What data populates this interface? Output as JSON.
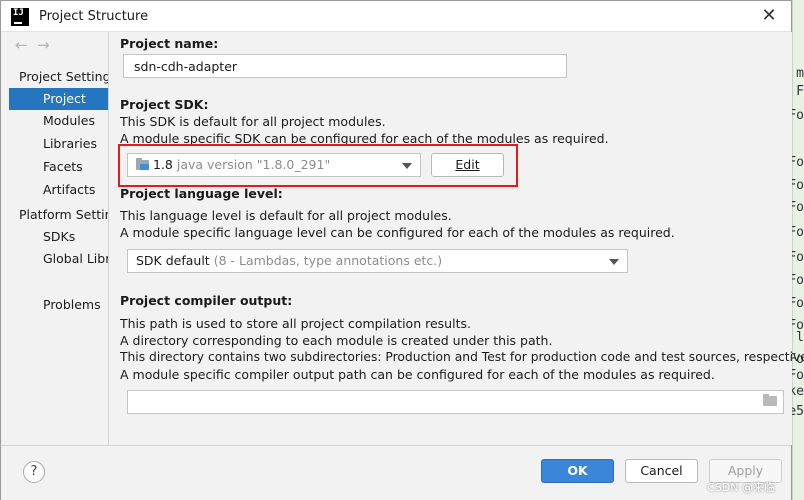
{
  "window": {
    "title": "Project Structure",
    "close_glyph": "✕",
    "app_icon_text": "IJ"
  },
  "sidebar": {
    "back_arrow": "←",
    "forward_arrow": "→",
    "project_settings_header": "Project Settings",
    "project_settings_items": [
      {
        "label": "Project",
        "selected": true
      },
      {
        "label": "Modules"
      },
      {
        "label": "Libraries"
      },
      {
        "label": "Facets"
      },
      {
        "label": "Artifacts"
      }
    ],
    "platform_settings_header": "Platform Settings",
    "platform_settings_items": [
      {
        "label": "SDKs"
      },
      {
        "label": "Global Libraries"
      }
    ],
    "problems_label": "Problems"
  },
  "project_name": {
    "label": "Project name:",
    "value": "sdn-cdh-adapter"
  },
  "project_sdk": {
    "label": "Project SDK:",
    "desc_line1": "This SDK is default for all project modules.",
    "desc_line2": "A module specific SDK can be configured for each of the modules as required.",
    "selected_version": "1.8",
    "selected_detail": "java version \"1.8.0_291\"",
    "edit_button": "Edit"
  },
  "language_level": {
    "label": "Project language level:",
    "desc_line1": "This language level is default for all project modules.",
    "desc_line2": "A module specific language level can be configured for each of the modules as required.",
    "selected_value": "SDK default",
    "selected_detail": "(8 - Lambdas, type annotations etc.)"
  },
  "compiler_output": {
    "label": "Project compiler output:",
    "desc_line1": "This path is used to store all project compilation results.",
    "desc_line2": "A directory corresponding to each module is created under this path.",
    "desc_line3": "This directory contains two subdirectories: Production and Test for production code and test sources, respectively.",
    "desc_line4": "A module specific compiler output path can be configured for each of the modules as required.",
    "value": ""
  },
  "footer": {
    "help_glyph": "?",
    "ok_label": "OK",
    "cancel_label": "Cancel",
    "apply_label": "Apply"
  },
  "watermark": "CSDN @来临",
  "background_chars": [
    "m",
    "F",
    "Fo",
    "Fo",
    "Fo",
    "Fo",
    "Fo",
    "Fo",
    "Fo",
    "Fo",
    "Fo",
    "l",
    "Fo",
    "Fo",
    "ke",
    "e5"
  ],
  "colors": {
    "selection": "#2675bf",
    "ok_button": "#3b86d8",
    "highlight_border": "#e8191c"
  }
}
